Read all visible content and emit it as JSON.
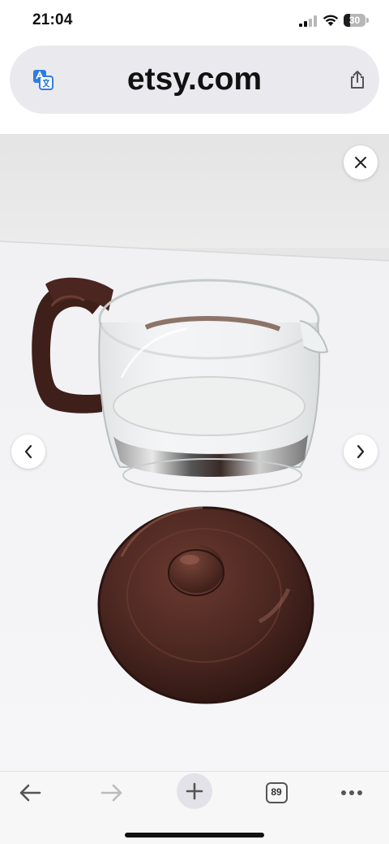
{
  "status_bar": {
    "time": "21:04",
    "battery_level": 30,
    "battery_label": "30",
    "signal_icon": "cellular-signal-icon",
    "wifi_icon": "wifi-icon"
  },
  "address_bar": {
    "url": "etsy.com",
    "left_icon": "translate-icon",
    "right_icon": "share-icon"
  },
  "viewer": {
    "photo_subject": "brown-lid-glass-coffee-pot-photo",
    "close_icon": "close-icon",
    "prev_icon": "chevron-left-icon",
    "next_icon": "chevron-right-icon"
  },
  "toolbar": {
    "back_icon": "arrow-left-icon",
    "forward_icon": "arrow-right-icon",
    "new_tab_icon": "plus-icon",
    "tab_count": "89",
    "more_icon": "more-dots-icon"
  },
  "colors": {
    "address_bar_bg": "#e9e9ee",
    "lid_brown": "#4a2620",
    "toolbar_bg": "#f7f7f7"
  }
}
